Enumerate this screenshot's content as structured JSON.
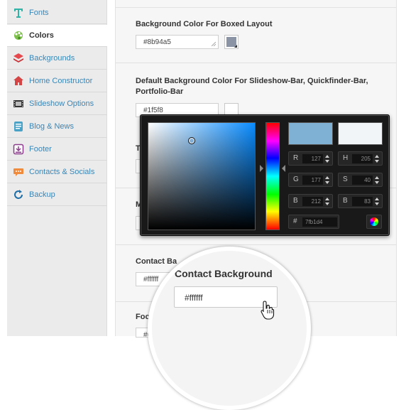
{
  "sidebar": {
    "items": [
      {
        "label": "Fonts",
        "icon": "font-icon",
        "active": false
      },
      {
        "label": "Colors",
        "icon": "palette-icon",
        "active": true
      },
      {
        "label": "Backgrounds",
        "icon": "layers-icon",
        "active": false
      },
      {
        "label": "Home Constructor",
        "icon": "house-icon",
        "active": false
      },
      {
        "label": "Slideshow Options",
        "icon": "film-icon",
        "active": false
      },
      {
        "label": "Blog & News",
        "icon": "news-icon",
        "active": false
      },
      {
        "label": "Footer",
        "icon": "footer-icon",
        "active": false
      },
      {
        "label": "Contacts & Socials",
        "icon": "speech-bubble-icon",
        "active": false
      },
      {
        "label": "Backup",
        "icon": "refresh-icon",
        "active": false
      }
    ]
  },
  "main": {
    "fields": [
      {
        "label": "Background Color For Boxed Layout",
        "value": "#8b94a5",
        "swatch": "#8b94a5"
      },
      {
        "label": "Default Background Color For Slideshow-Bar, Quickfinder-Bar, Portfolio-Bar",
        "value": "#1f5f8",
        "swatch": "#ffffff"
      },
      {
        "label": "Contact Background",
        "value": "#ffffff"
      }
    ],
    "partials": {
      "field3": "T",
      "field4": "M",
      "field6": "Foo",
      "field6_value": "#0"
    }
  },
  "picker": {
    "new_color": "#7fb1d4",
    "old_color": "#f1f5f8",
    "r": {
      "label": "R",
      "value": "127"
    },
    "g": {
      "label": "G",
      "value": "177"
    },
    "b": {
      "label": "B",
      "value": "212"
    },
    "h": {
      "label": "H",
      "value": "205"
    },
    "s": {
      "label": "S",
      "value": "40"
    },
    "v": {
      "label": "B",
      "value": "83"
    },
    "hex": {
      "label": "#",
      "value": "7fb1d4"
    }
  },
  "magnifier": {
    "label": "Contact Background",
    "value": "#ffffff"
  },
  "colors": {
    "link": "#3a86b7",
    "sidebar_bg": "#ebebeb",
    "picker_bg": "#191919"
  }
}
